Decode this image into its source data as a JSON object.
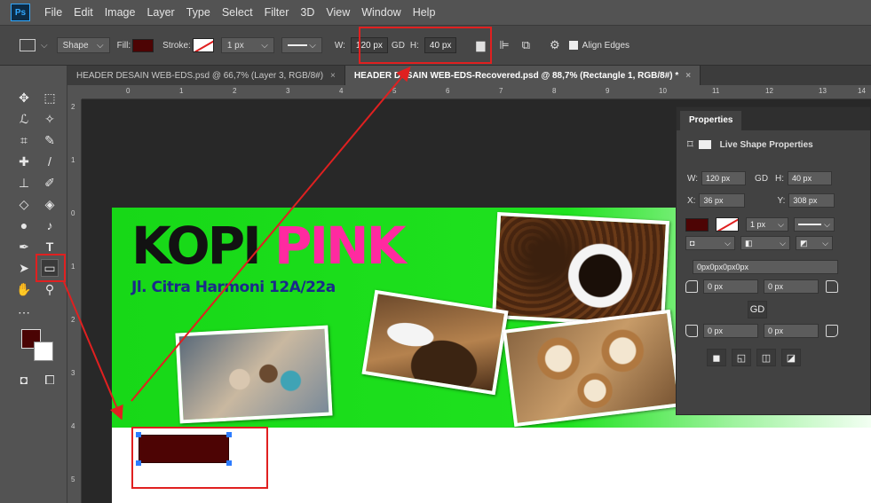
{
  "app": {
    "logo": "Ps"
  },
  "menu": [
    "File",
    "Edit",
    "Image",
    "Layer",
    "Type",
    "Select",
    "Filter",
    "3D",
    "View",
    "Window",
    "Help"
  ],
  "options_bar": {
    "mode": "Shape",
    "fill_label": "Fill:",
    "fill_color": "#4d0404",
    "stroke_label": "Stroke:",
    "stroke_width": "1 px",
    "w_label": "W:",
    "w_value": "120 px",
    "link_icon": "GD",
    "h_label": "H:",
    "h_value": "40 px",
    "align_edges_label": "Align Edges"
  },
  "tabs": [
    {
      "label": "HEADER DESAIN WEB-EDS.psd @ 66,7% (Layer 3, RGB/8#)",
      "close": "×"
    },
    {
      "label": "HEADER DESAIN WEB-EDS-Recovered.psd @ 88,7% (Rectangle 1, RGB/8#) *",
      "close": "×"
    }
  ],
  "ruler": {
    "h_labels": [
      "0",
      "1",
      "2",
      "3",
      "4",
      "5",
      "6",
      "7",
      "8",
      "9",
      "10",
      "11",
      "12",
      "13",
      "14"
    ],
    "v_labels": [
      "2",
      "1",
      "0",
      "1",
      "2",
      "3",
      "4",
      "5"
    ]
  },
  "banner": {
    "title_dark": "KOPI ",
    "title_pink": "PINK",
    "address": "Jl. Citra Harmoni 12A/22a"
  },
  "properties": {
    "tab": "Properties",
    "section": "Live Shape Properties",
    "w_label": "W:",
    "w_value": "120 px",
    "h_label": "H:",
    "h_value": "40 px",
    "x_label": "X:",
    "x_value": "36 px",
    "y_label": "Y:",
    "y_value": "308 px",
    "stroke_width": "1 px",
    "corner_combined": "0px0px0px0px",
    "corner_tl": "0 px",
    "corner_tr": "0 px",
    "corner_bl": "0 px",
    "corner_br": "0 px",
    "link_icon": "GD"
  },
  "colors": {
    "foreground": "#4d0404",
    "background": "#ffffff",
    "annotation": "#e02020",
    "banner_green": "#1fe21f",
    "pink": "#ff2aa0"
  }
}
